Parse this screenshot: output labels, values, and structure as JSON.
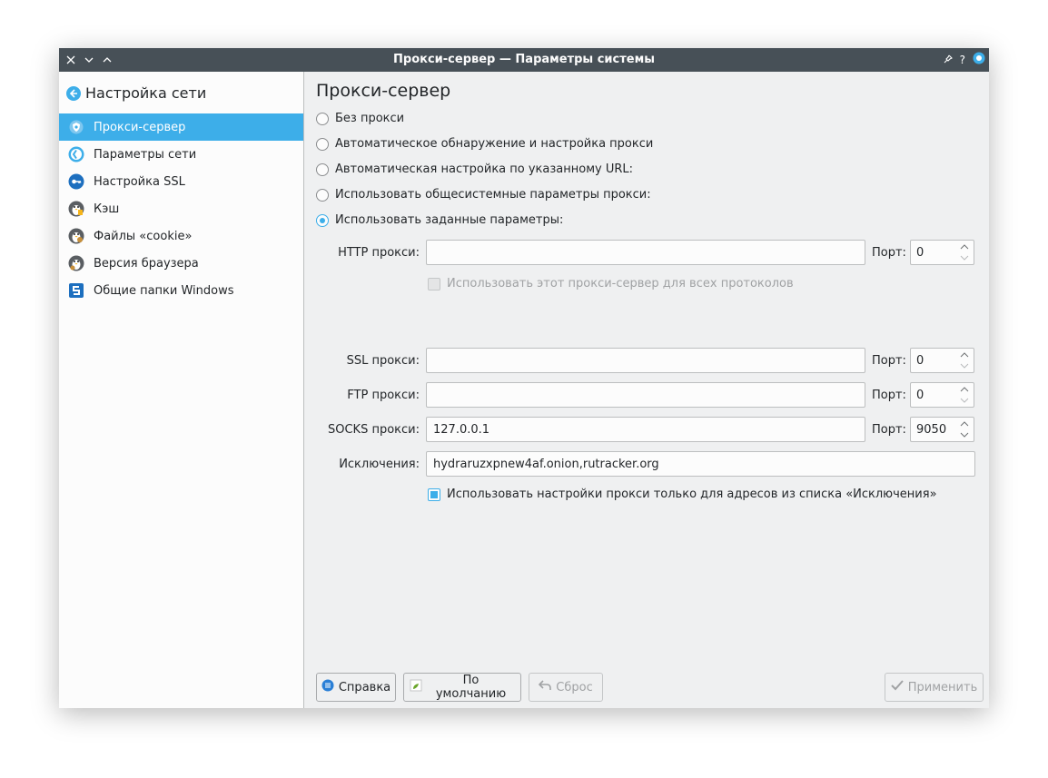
{
  "window": {
    "title": "Прокси-сервер — Параметры системы"
  },
  "sidebar": {
    "back_title": "Настройка сети",
    "items": [
      {
        "label": "Прокси-сервер",
        "icon": "proxy-shield-icon",
        "selected": true
      },
      {
        "label": "Параметры сети",
        "icon": "network-globe-icon"
      },
      {
        "label": "Настройка SSL",
        "icon": "ssl-key-icon"
      },
      {
        "label": "Кэш",
        "icon": "cache-penguin-icon"
      },
      {
        "label": "Файлы «cookie»",
        "icon": "cookie-penguin-icon"
      },
      {
        "label": "Версия браузера",
        "icon": "browser-penguin-icon"
      },
      {
        "label": "Общие папки Windows",
        "icon": "samba-icon"
      }
    ]
  },
  "main": {
    "title": "Прокси-сервер",
    "radios": [
      {
        "label": "Без прокси",
        "checked": false
      },
      {
        "label": "Автоматическое обнаружение и настройка прокси",
        "checked": false
      },
      {
        "label": "Автоматическая настройка по указанному URL:",
        "checked": false
      },
      {
        "label": "Использовать общесистемные параметры прокси:",
        "checked": false
      },
      {
        "label": "Использовать заданные параметры:",
        "checked": true
      }
    ],
    "port_label": "Порт:",
    "http": {
      "label": "HTTP прокси:",
      "value": "",
      "port": "0"
    },
    "use_for_all": {
      "label": "Использовать этот прокси-сервер для всех протоколов",
      "checked": false,
      "enabled": false
    },
    "ssl": {
      "label": "SSL прокси:",
      "value": "",
      "port": "0"
    },
    "ftp": {
      "label": "FTP прокси:",
      "value": "",
      "port": "0"
    },
    "socks": {
      "label": "SOCKS прокси:",
      "value": "127.0.0.1",
      "port": "9050"
    },
    "exceptions": {
      "label": "Исключения:",
      "value": "hydraruzxpnew4af.onion,rutracker.org"
    },
    "only_exceptions": {
      "label": "Использовать настройки прокси только для адресов из списка «Исключения»",
      "checked": true
    }
  },
  "buttons": {
    "help": "Справка",
    "defaults": "По умолчанию",
    "reset": "Сброс",
    "apply": "Применить"
  },
  "colors": {
    "accent": "#3daee9",
    "titlebar": "#475057",
    "window_bg": "#eff0f1"
  }
}
